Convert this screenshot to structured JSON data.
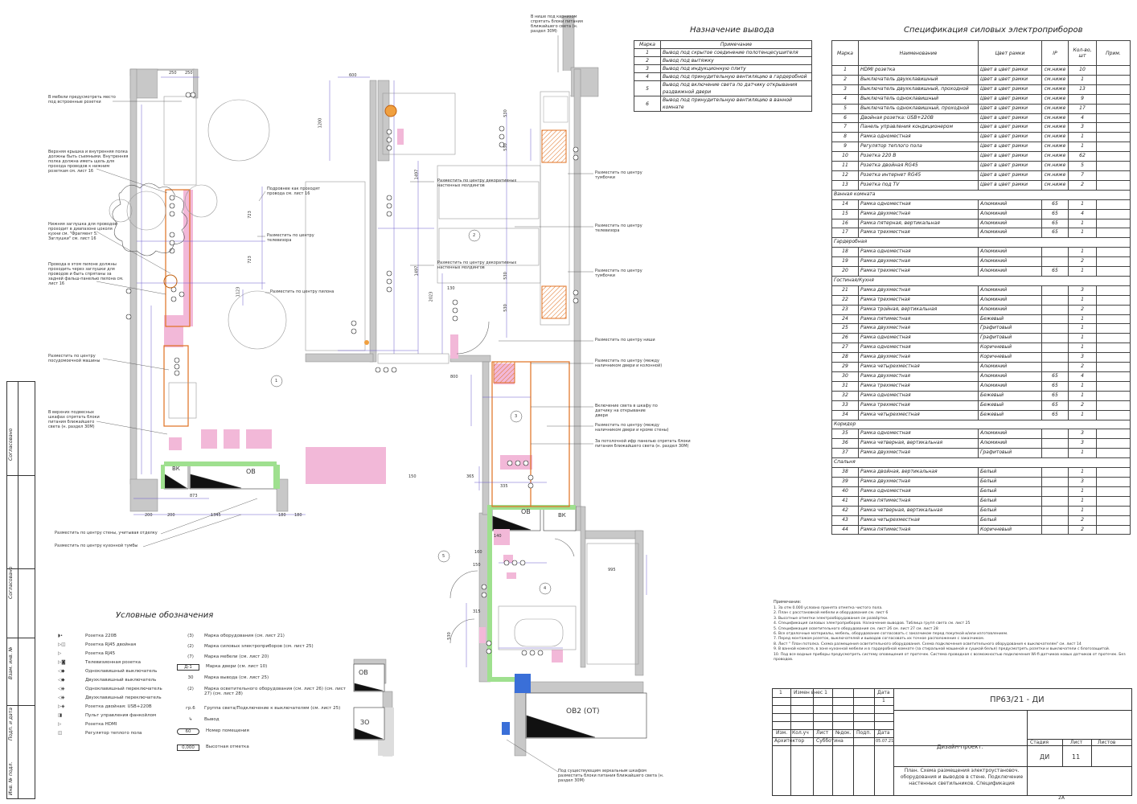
{
  "outputs_table": {
    "title": "Назначение вывода",
    "headers": [
      "Марка",
      "Примечание"
    ],
    "rows": [
      [
        "1",
        "Вывод под скрытое соединение полотенцесушителя"
      ],
      [
        "2",
        "Вывод под вытяжку"
      ],
      [
        "3",
        "Вывод под индукционную плиту"
      ],
      [
        "4",
        "Вывод под принудительную вентиляцию в гардеробной"
      ],
      [
        "5",
        "Вывод под включение света по датчику открывания раздвижной двери"
      ],
      [
        "6",
        "Вывод под принудительную вентиляцию в ванной комнате"
      ]
    ]
  },
  "spec_table": {
    "title": "Спецификация силовых электроприборов",
    "headers": [
      "Марка",
      "Наименование",
      "Цвет рамки",
      "IP",
      "Кол-во, шт",
      "Прим."
    ],
    "rows": [
      {
        "type": "row",
        "cells": [
          "1",
          "HDMI розетка",
          "Цвет в цвет рамки",
          "см.ниже",
          "10",
          ""
        ]
      },
      {
        "type": "row",
        "cells": [
          "2",
          "Выключатель двухклавишный",
          "Цвет в цвет рамки",
          "см.ниже",
          "1",
          ""
        ]
      },
      {
        "type": "row",
        "cells": [
          "3",
          "Выключатель двухклавишный, проходной",
          "Цвет в цвет рамки",
          "см.ниже",
          "13",
          ""
        ]
      },
      {
        "type": "row",
        "cells": [
          "4",
          "Выключатель одноклавишный",
          "Цвет в цвет рамки",
          "см.ниже",
          "9",
          ""
        ]
      },
      {
        "type": "row",
        "cells": [
          "5",
          "Выключатель одноклавишный, проходной",
          "Цвет в цвет рамки",
          "см.ниже",
          "17",
          ""
        ]
      },
      {
        "type": "row",
        "cells": [
          "6",
          "Двойная розетка: USB+220В",
          "Цвет в цвет рамки",
          "см.ниже",
          "4",
          ""
        ]
      },
      {
        "type": "row",
        "cells": [
          "7",
          "Панель управления кондиционером",
          "Цвет в цвет рамки",
          "см.ниже",
          "3",
          ""
        ]
      },
      {
        "type": "row",
        "cells": [
          "8",
          "Рамка одноместная",
          "Цвет в цвет рамки",
          "см.ниже",
          "1",
          ""
        ]
      },
      {
        "type": "row",
        "cells": [
          "9",
          "Регулятор теплого пола",
          "Цвет в цвет рамки",
          "см.ниже",
          "1",
          ""
        ]
      },
      {
        "type": "row",
        "cells": [
          "10",
          "Розетка 220 В",
          "Цвет в цвет рамки",
          "см.ниже",
          "62",
          ""
        ]
      },
      {
        "type": "row",
        "cells": [
          "11",
          "Розетка двойная RG45",
          "Цвет в цвет рамки",
          "см.ниже",
          "5",
          ""
        ]
      },
      {
        "type": "row",
        "cells": [
          "12",
          "Розетка интернет RG45",
          "Цвет в цвет рамки",
          "см.ниже",
          "7",
          ""
        ]
      },
      {
        "type": "row",
        "cells": [
          "13",
          "Розетка под TV",
          "Цвет в цвет рамки",
          "см.ниже",
          "2",
          ""
        ]
      },
      {
        "type": "sec",
        "label": "Ванная комната"
      },
      {
        "type": "row",
        "cells": [
          "14",
          "Рамка одноместная",
          "Алюминий",
          "65",
          "1",
          ""
        ]
      },
      {
        "type": "row",
        "cells": [
          "15",
          "Рамка двухместная",
          "Алюминий",
          "65",
          "4",
          ""
        ]
      },
      {
        "type": "row",
        "cells": [
          "16",
          "Рамка пятерная, вертикальная",
          "Алюминий",
          "65",
          "1",
          ""
        ]
      },
      {
        "type": "row",
        "cells": [
          "17",
          "Рамка трехместная",
          "Алюминий",
          "65",
          "1",
          ""
        ]
      },
      {
        "type": "sec",
        "label": "Гардеробная"
      },
      {
        "type": "row",
        "cells": [
          "18",
          "Рамка одноместная",
          "Алюминий",
          "",
          "1",
          ""
        ]
      },
      {
        "type": "row",
        "cells": [
          "19",
          "Рамка двухместная",
          "Алюминий",
          "",
          "2",
          ""
        ]
      },
      {
        "type": "row",
        "cells": [
          "20",
          "Рамка трехместная",
          "Алюминий",
          "65",
          "1",
          ""
        ]
      },
      {
        "type": "sec",
        "label": "Гостиная/Кухня"
      },
      {
        "type": "row",
        "cells": [
          "21",
          "Рамка двухместная",
          "Алюминий",
          "",
          "3",
          ""
        ]
      },
      {
        "type": "row",
        "cells": [
          "22",
          "Рамка трехместная",
          "Алюминий",
          "",
          "1",
          ""
        ]
      },
      {
        "type": "row",
        "cells": [
          "23",
          "Рамка тройная, вертикальная",
          "Алюминий",
          "",
          "2",
          ""
        ]
      },
      {
        "type": "row",
        "cells": [
          "24",
          "Рамка пятиместная",
          "Бежевый",
          "",
          "1",
          ""
        ]
      },
      {
        "type": "row",
        "cells": [
          "25",
          "Рамка двухместная",
          "Графитовый",
          "",
          "1",
          ""
        ]
      },
      {
        "type": "row",
        "cells": [
          "26",
          "Рамка одноместная",
          "Графитовый",
          "",
          "1",
          ""
        ]
      },
      {
        "type": "row",
        "cells": [
          "27",
          "Рамка одноместная",
          "Коричневый",
          "",
          "1",
          ""
        ]
      },
      {
        "type": "row",
        "cells": [
          "28",
          "Рамка двухместная",
          "Коричневый",
          "",
          "3",
          ""
        ]
      },
      {
        "type": "row",
        "cells": [
          "29",
          "Рамка четырехместная",
          "Алюминий",
          "",
          "2",
          ""
        ]
      },
      {
        "type": "row",
        "cells": [
          "30",
          "Рамка двухместная",
          "Алюминий",
          "65",
          "4",
          ""
        ]
      },
      {
        "type": "row",
        "cells": [
          "31",
          "Рамка трехместная",
          "Алюминий",
          "65",
          "1",
          ""
        ]
      },
      {
        "type": "row",
        "cells": [
          "32",
          "Рамка одноместная",
          "Бежевый",
          "65",
          "1",
          ""
        ]
      },
      {
        "type": "row",
        "cells": [
          "33",
          "Рамка трехместная",
          "Бежевый",
          "65",
          "2",
          ""
        ]
      },
      {
        "type": "row",
        "cells": [
          "34",
          "Рамка четырехместная",
          "Бежевый",
          "65",
          "1",
          ""
        ]
      },
      {
        "type": "sec",
        "label": "Коридор"
      },
      {
        "type": "row",
        "cells": [
          "35",
          "Рамка одноместная",
          "Алюминий",
          "",
          "3",
          ""
        ]
      },
      {
        "type": "row",
        "cells": [
          "36",
          "Рамка четверная, вертикальная",
          "Алюминий",
          "",
          "3",
          ""
        ]
      },
      {
        "type": "row",
        "cells": [
          "37",
          "Рамка двухместная",
          "Графитовый",
          "",
          "1",
          ""
        ]
      },
      {
        "type": "sec",
        "label": "Спальня"
      },
      {
        "type": "row",
        "cells": [
          "38",
          "Рамка двойная, вертикальная",
          "Белый",
          "",
          "1",
          ""
        ]
      },
      {
        "type": "row",
        "cells": [
          "39",
          "Рамка двухместная",
          "Белый",
          "",
          "3",
          ""
        ]
      },
      {
        "type": "row",
        "cells": [
          "40",
          "Рамка одноместная",
          "Белый",
          "",
          "1",
          ""
        ]
      },
      {
        "type": "row",
        "cells": [
          "41",
          "Рамка пятиместная",
          "Белый",
          "",
          "1",
          ""
        ]
      },
      {
        "type": "row",
        "cells": [
          "42",
          "Рамка четверная, вертикальная",
          "Белый",
          "",
          "1",
          ""
        ]
      },
      {
        "type": "row",
        "cells": [
          "43",
          "Рамка четырехместная",
          "Белый",
          "",
          "2",
          ""
        ]
      },
      {
        "type": "row",
        "cells": [
          "44",
          "Рамка пятиместная",
          "Коричневый",
          "",
          "2",
          ""
        ]
      }
    ]
  },
  "legend": {
    "title": "Условные обозначения",
    "left": [
      {
        "sym": "◗•",
        "label": "Розетка 220В"
      },
      {
        "sym": "▷◫",
        "label": "Розетка RJ45 двойная"
      },
      {
        "sym": "▷",
        "label": "Розетка RJ45"
      },
      {
        "sym": "▷◙",
        "label": "Телевизионная розетка"
      },
      {
        "sym": "◁◆",
        "label": "Одноклавишный выключатель"
      },
      {
        "sym": "◁◆",
        "label": "Двухклавишный выключатель"
      },
      {
        "sym": "◁◈",
        "label": "Одноклавишный переключатель"
      },
      {
        "sym": "◁◈",
        "label": "Двухклавишный переключатель"
      },
      {
        "sym": "▷◈",
        "label": "Розетка двойная: USB+220В"
      },
      {
        "sym": "◨",
        "label": "Пульт управления фанкойлом"
      },
      {
        "sym": "▷",
        "label": "Розетка HDMI"
      },
      {
        "sym": "◫",
        "label": "Регулятор теплого пола"
      }
    ],
    "right": [
      {
        "sym": "(3)",
        "label": "Марка оборудования  (см. лист 21)"
      },
      {
        "sym": "(2)",
        "label": "Марка силовых электроприборов  (см. лист 25)"
      },
      {
        "sym": "(7)",
        "label": "Марка мебели  (см. лист 20)"
      },
      {
        "sym": "Д-1",
        "label": "Марка двери  (см. лист 10)"
      },
      {
        "sym": "30",
        "label": "Марка вывода  (см. лист 25)"
      },
      {
        "sym": "(2)",
        "label": "Марка осветительного оборудования  (см. лист 26) (см. лист 27) (см. лист 28)"
      },
      {
        "sym": "гр.6",
        "label": "Группа света/Подключение к выключателям  (см. лист 25)"
      },
      {
        "sym": "↳",
        "label": "Вывод"
      },
      {
        "sym": "60",
        "label": "Номер помещения"
      },
      {
        "sym": "0,000",
        "label": "Высотная отметка"
      }
    ]
  },
  "notes": {
    "title": "Примечание:",
    "items": [
      "1.   За отм 0.000 условно принята отметка чистого пола.",
      "2.   План с расстановкой мебели и оборудования  см. лист 6",
      "3.   Высотные отметки электрооборудования см развёртки.",
      "4.   Спецификация силовых электроприборов. Назначение выводов. Таблица групп света  см. лист 25",
      "5.   Спецификация осветительного оборудования  см. лист 26  см. лист 27  см. лист 28",
      "6.   Все отделочные материалы, мебель, оборудование согласовать с заказчиком перед покупкой и/или изготовлением.",
      "7.   Перед монтажом розеток, выключателей и выводов согласовать их точное расположение с заказчиком.",
      "8.   Лист \" План потолка. Схема размещения осветительного оборудования. Схема подключения осветительного оборудования к выключателям\"  см. лист 14",
      "9.   В ванной комнате, в зоне кухонной мебели и в гардеробной комнате (за стиральной машиной и сушкой белья) предусмотреть розетки и выключатели с блогозащитой.",
      "10.  Под все водные приборы предусмотреть систему оповещения от протечек. Система проводная с возможностью подключения Wi-fi-датчиков новых датчиков от протечек. Без проводов."
    ]
  },
  "stamp": {
    "code": "ПР63/21 - ДИ",
    "change_row": [
      "1",
      "Измен внес 1",
      "",
      "",
      "",
      "",
      "1"
    ],
    "date_label": "Дата",
    "headers": [
      "Изм.",
      "Кол.уч",
      "Лист",
      "№док.",
      "Подп.",
      "Дата"
    ],
    "role": "Архитектор",
    "person": "Субботина",
    "date": "05.07.21",
    "project": "Дизайн-проект.",
    "stage_label": "Стадия",
    "sheet_label": "Лист",
    "sheets_label": "Листов",
    "stage": "ДИ",
    "sheet": "11",
    "description": "План. Схема размещения электроустановоч. оборудования и выводов в стене. Подключение настенных светильников. Спецификация",
    "format": "2А"
  },
  "side_frame": {
    "labels": [
      "Согласовано",
      "Согласовано",
      "Взам. инв. №",
      "Подп. и дата",
      "Инв. № подл."
    ]
  },
  "plan": {
    "rooms": [
      "1",
      "2",
      "3",
      "4",
      "5"
    ],
    "tags": [
      "ВК",
      "ОВ",
      "ВК",
      "ОВ",
      "ОВ",
      "ОВ2 (ОТ)",
      "ЗО"
    ],
    "callouts": [
      "В нише под карнизом спрятать блоки питания ближайшего света (н. раздел 30М)",
      "В мебели предусмотреть место под встроенные розетки",
      "Верхняя крышка и внутренняя полка должны быть съемными. Внутренняя полка должна иметь щель для прохода проводов к нижним розеткам  см. лист 16",
      "Нижняя заглушка для проводов проходит в диапазоне цоколя кухни см. \"Фрагмент 5. Заглушки\"  см. лист 16",
      "Провода в этом пилоне должны проходить через заглушки для проводов и быть спрятаны за задней фальш-панелью пилона  см. лист 16",
      "Разместить по центру посудомоечной машины",
      "В верхних подвесных шкафах спрятать блоки питания ближайшего света (н. раздел 30М)",
      "Подровнее как проходят провода  см. лист 16",
      "Разместить по центру телевизора",
      "Разместить по центру пилона",
      "Разместить по центру декоративных настенных молдингов",
      "Разместить по центру тумбочки",
      "Разместить по центру телевизора",
      "Разместить по центру декоративных настенных молдингов",
      "Разместить по центру тумбочки",
      "Разместить по центру ниши",
      "Разместить по центру (между наличником двери и колонной)",
      "Включение света в шкафу по датчику на открывание двери",
      "Разместить по центру (между наличником двери и кроме стены)",
      "За потолочной ифр панелью спрятать блоки питания ближайшего света (н. раздел 30М)",
      "Разместить по центру стены, учитывая отделку",
      "Разместить по центру кухонной тумбы",
      "Под существующим зеркальным шкафом разместить блоки питания ближайшего света (н. раздел 30М)"
    ],
    "dims": [
      "250",
      "250",
      "600",
      "1200",
      "530",
      "530",
      "530",
      "530",
      "723",
      "723",
      "1497",
      "1497",
      "1123",
      "2023",
      "800",
      "873",
      "1345",
      "200",
      "200",
      "180",
      "180",
      "150",
      "365",
      "335",
      "995",
      "530",
      "130",
      "160",
      "140",
      "150",
      "315"
    ]
  }
}
